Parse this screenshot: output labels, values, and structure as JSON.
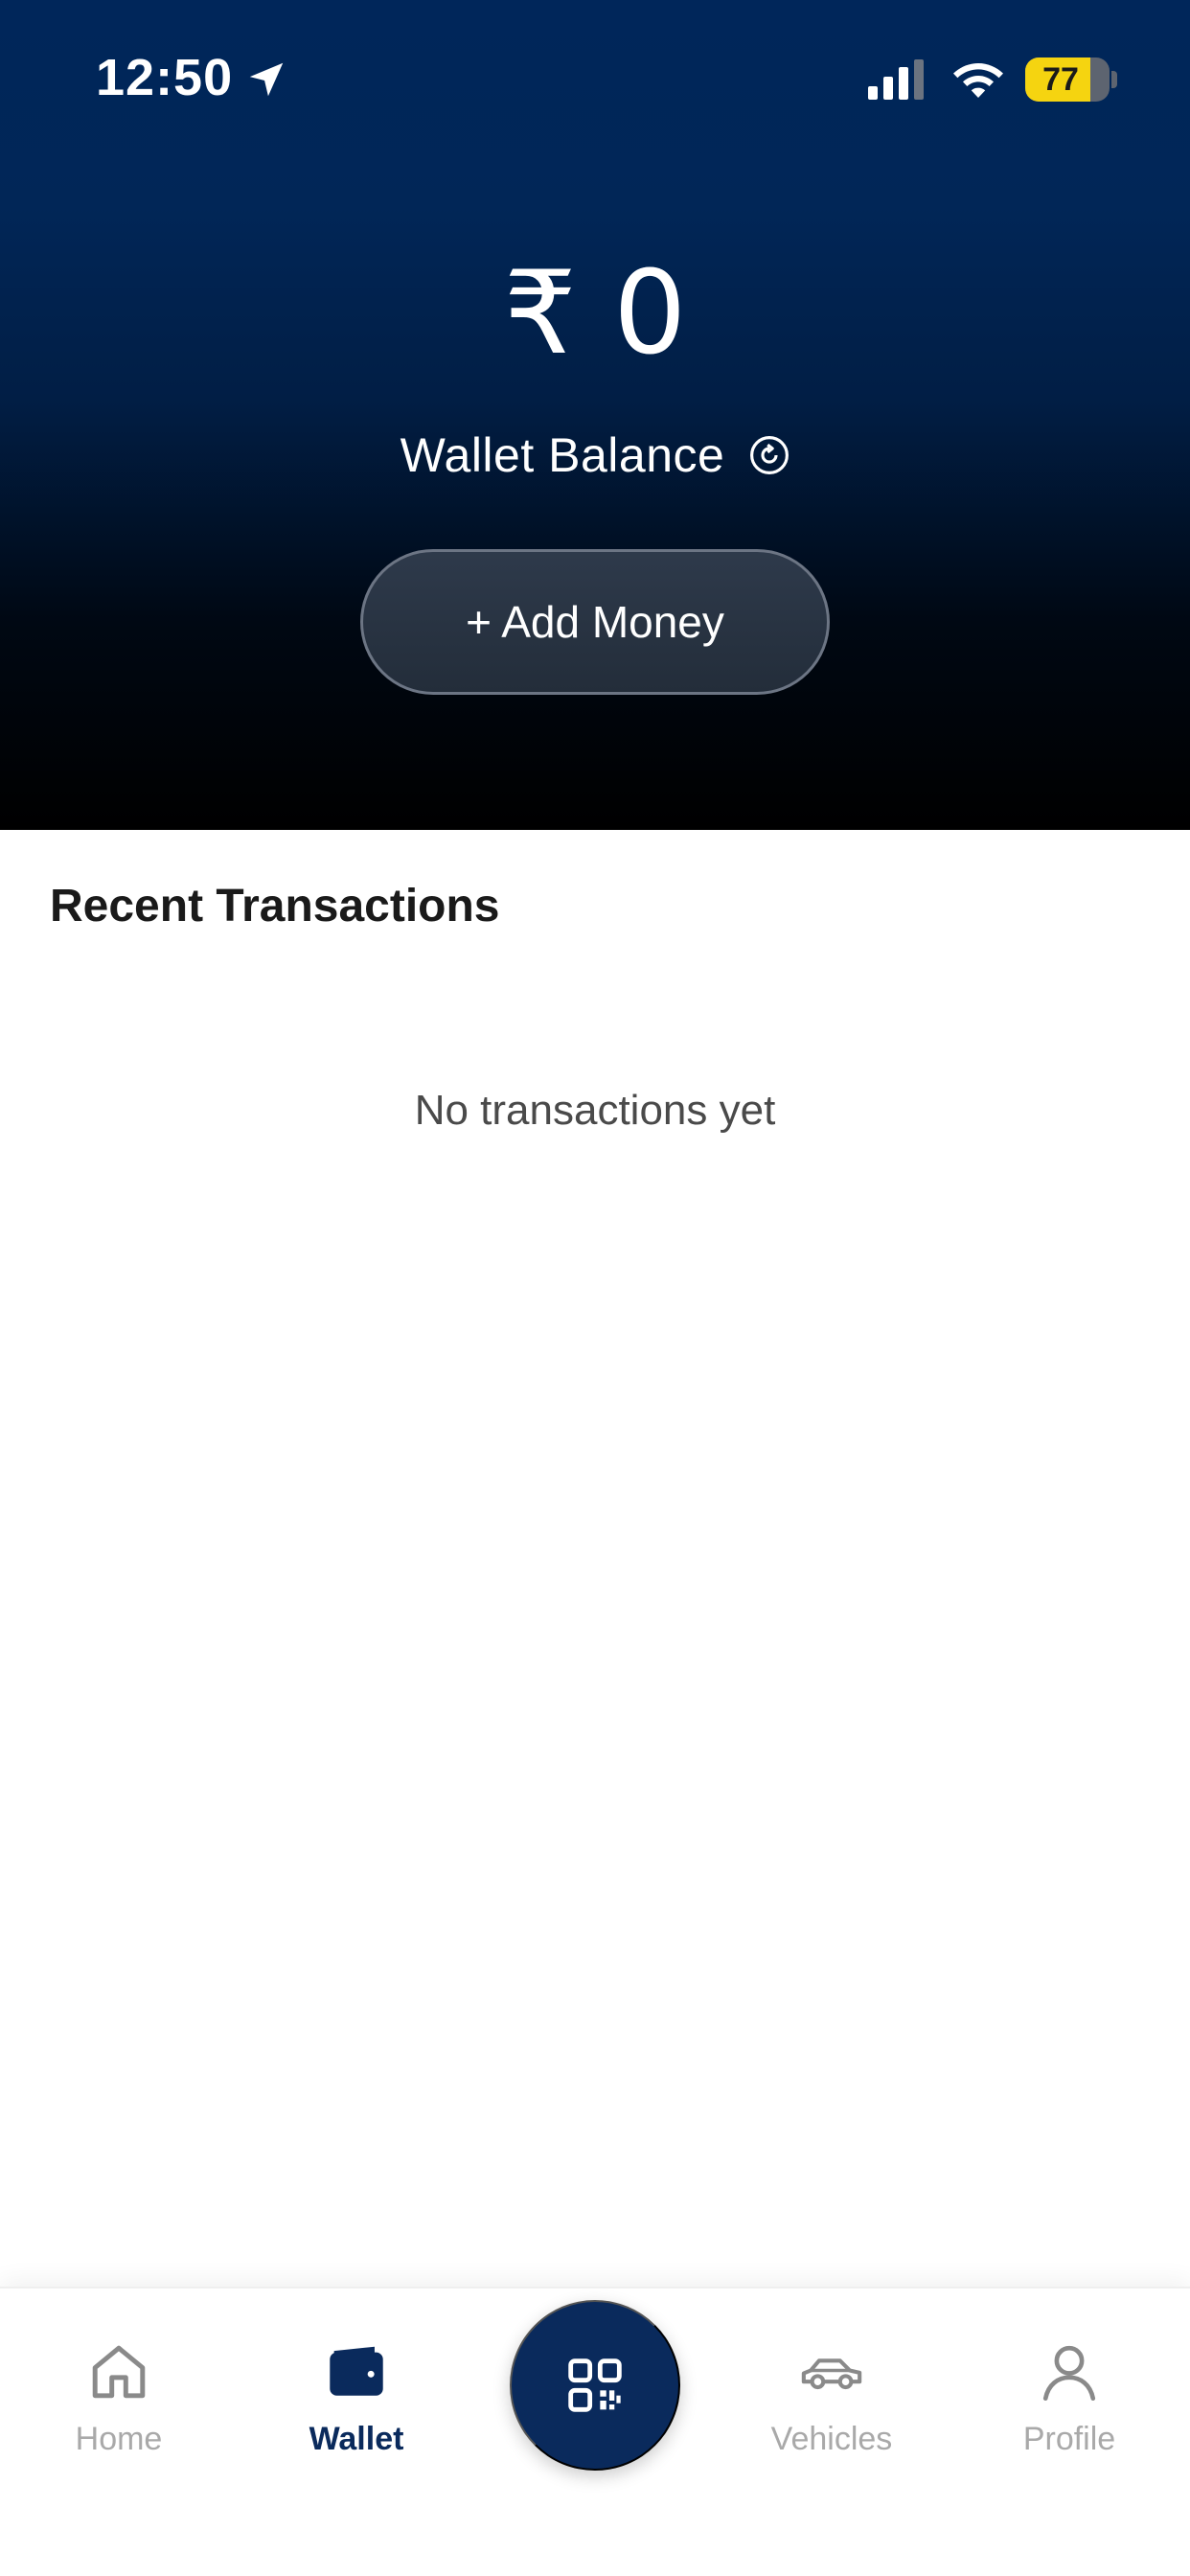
{
  "status_bar": {
    "time": "12:50",
    "battery_level": "77",
    "battery_fraction": 0.77,
    "battery_color": "#f5d410"
  },
  "wallet": {
    "balance": "₹ 0",
    "label": "Wallet Balance",
    "refresh_icon": "refresh-icon",
    "add_money_label": "+ Add Money"
  },
  "transactions": {
    "title": "Recent Transactions",
    "empty_message": "No transactions yet"
  },
  "bottom_nav": {
    "items": [
      {
        "label": "Home",
        "icon": "home-icon",
        "active": false
      },
      {
        "label": "Wallet",
        "icon": "wallet-icon",
        "active": true
      },
      {
        "label": "Vehicles",
        "icon": "car-icon",
        "active": false
      },
      {
        "label": "Profile",
        "icon": "user-icon",
        "active": false
      }
    ],
    "center_button_icon": "qr-code-icon"
  },
  "colors": {
    "brand_navy": "#0a2a5c",
    "inactive_gray": "#a9a9a9"
  }
}
